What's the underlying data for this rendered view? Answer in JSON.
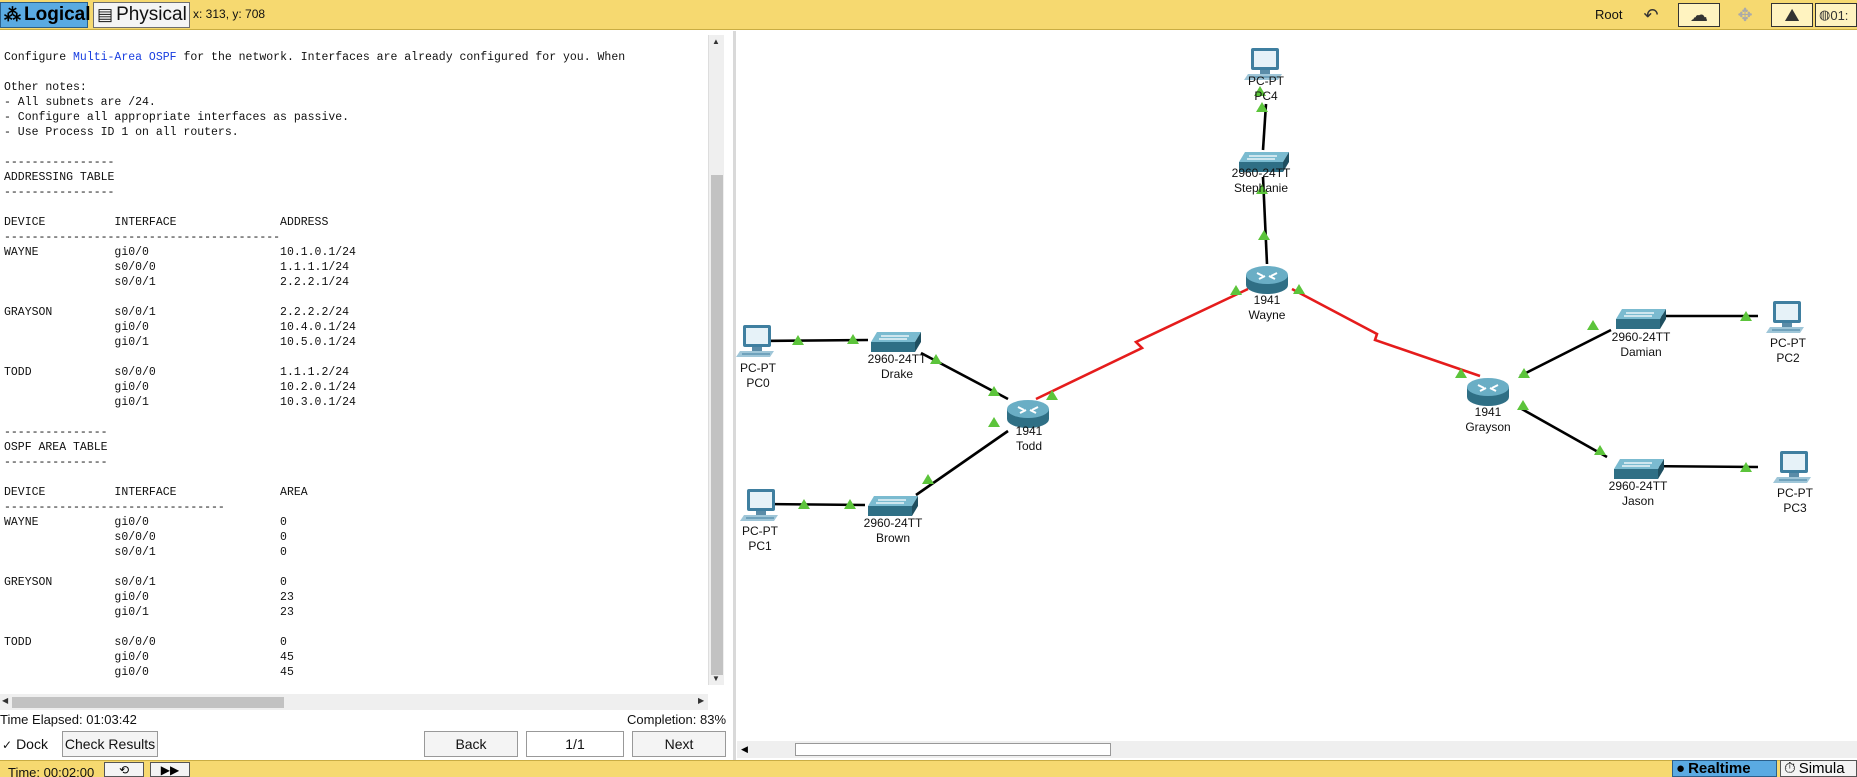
{
  "topbar": {
    "logical_label": "Logical",
    "physical_label": "Physical",
    "coords": "x: 313, y: 708",
    "root_label": "Root",
    "clock_partial": "01:"
  },
  "instructions": {
    "intro_pre": "Configure ",
    "intro_link": "Multi-Area OSPF",
    "intro_post": " for the network. Interfaces are already configured for you. When",
    "body": "\nOther notes:\n- All subnets are /24.\n- Configure all appropriate interfaces as passive.\n- Use Process ID 1 on all routers.\n\n----------------\nADDRESSING TABLE\n----------------\n\nDEVICE          INTERFACE               ADDRESS\n----------------------------------------\nWAYNE           gi0/0                   10.1.0.1/24\n                s0/0/0                  1.1.1.1/24\n                s0/0/1                  2.2.2.1/24\n\nGRAYSON         s0/0/1                  2.2.2.2/24\n                gi0/0                   10.4.0.1/24\n                gi0/1                   10.5.0.1/24\n\nTODD            s0/0/0                  1.1.1.2/24\n                gi0/0                   10.2.0.1/24\n                gi0/1                   10.3.0.1/24\n\n---------------\nOSPF AREA TABLE\n---------------\n\nDEVICE          INTERFACE               AREA\n--------------------------------\nWAYNE           gi0/0                   0\n                s0/0/0                  0\n                s0/0/1                  0\n\nGREYSON         s0/0/1                  0\n                gi0/0                   23\n                gi0/1                   23\n\nTODD            s0/0/0                  0\n                gi0/0                   45\n                gi0/0                   45"
  },
  "status": {
    "time_elapsed": "Time Elapsed: 01:03:42",
    "completion": "Completion: 83%"
  },
  "controls": {
    "dock_label": "Dock",
    "check_results": "Check Results",
    "back": "Back",
    "page": "1/1",
    "next": "Next"
  },
  "bottombar": {
    "time": "Time: 00:02:00",
    "realtime": "Realtime",
    "simulation": "Simula"
  },
  "topology": {
    "routers": [
      {
        "id": "wayne",
        "model": "1941",
        "name": "Wayne"
      },
      {
        "id": "todd",
        "model": "1941",
        "name": "Todd"
      },
      {
        "id": "grayson",
        "model": "1941",
        "name": "Grayson"
      }
    ],
    "switches": [
      {
        "id": "stephanie",
        "model": "2960-24TT",
        "name": "Stephanie"
      },
      {
        "id": "drake",
        "model": "2960-24TT",
        "name": "Drake"
      },
      {
        "id": "brown",
        "model": "2960-24TT",
        "name": "Brown"
      },
      {
        "id": "damian",
        "model": "2960-24TT",
        "name": "Damian"
      },
      {
        "id": "jason",
        "model": "2960-24TT",
        "name": "Jason"
      }
    ],
    "pcs": [
      {
        "id": "pc4",
        "model": "PC-PT",
        "name": "PC4"
      },
      {
        "id": "pc0",
        "model": "PC-PT",
        "name": "PC0"
      },
      {
        "id": "pc1",
        "model": "PC-PT",
        "name": "PC1"
      },
      {
        "id": "pc2",
        "model": "PC-PT",
        "name": "PC2"
      },
      {
        "id": "pc3",
        "model": "PC-PT",
        "name": "PC3"
      }
    ],
    "colors": {
      "ethernet_link": "#000000",
      "serial_link": "#e51c1c",
      "port_up": "#5cc43b",
      "device": "#3f8fa8"
    }
  }
}
